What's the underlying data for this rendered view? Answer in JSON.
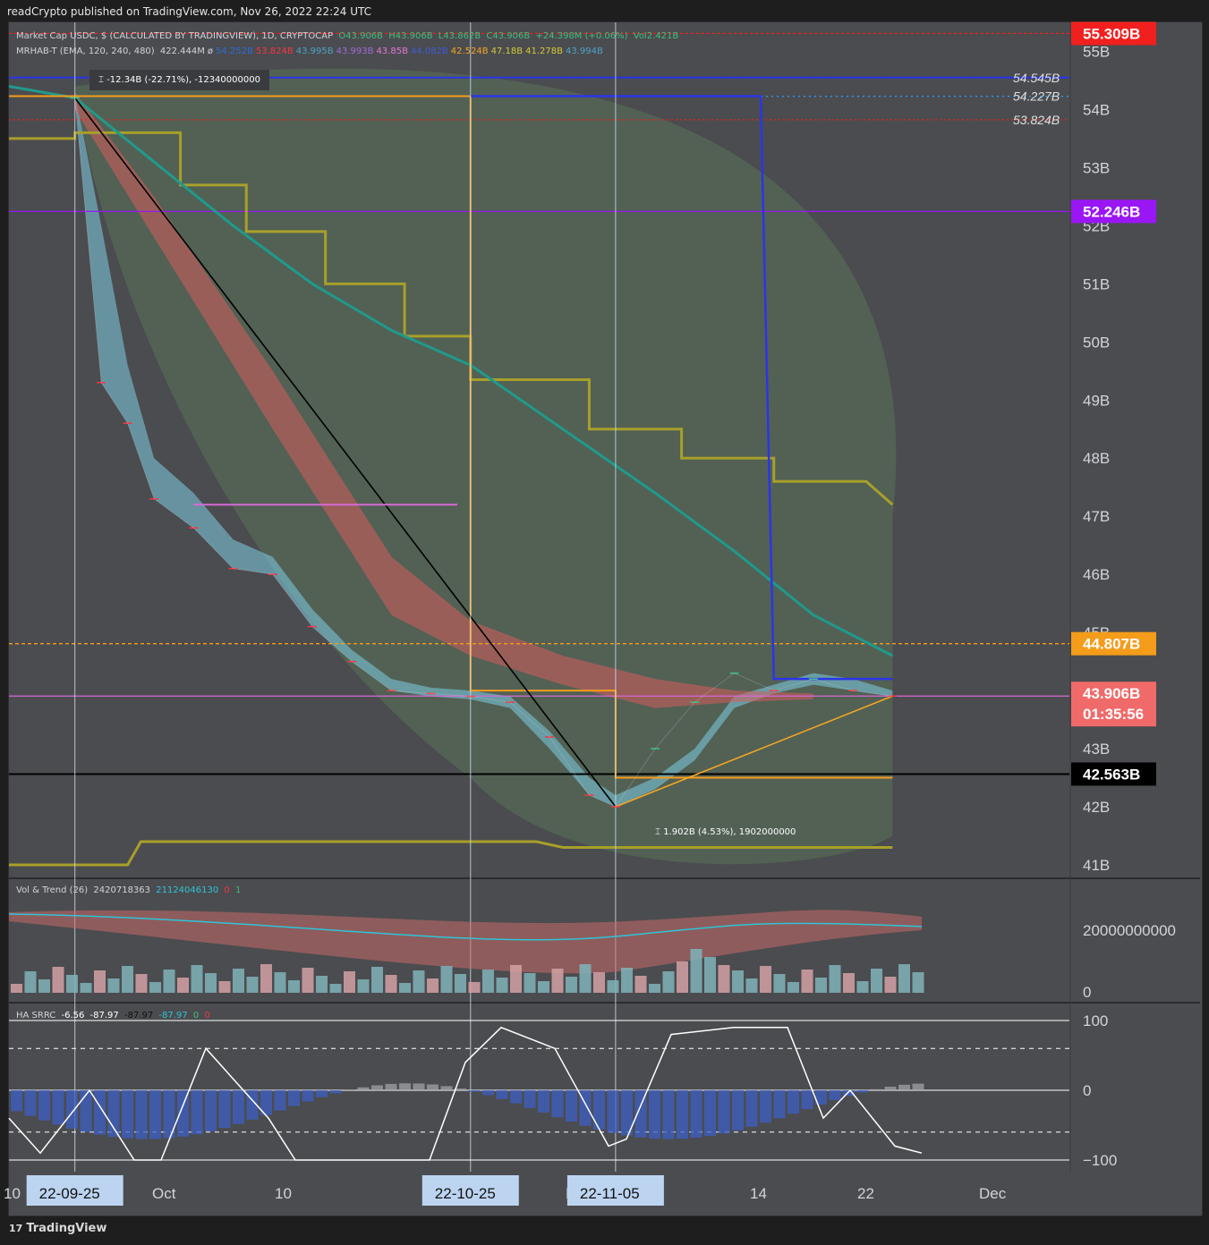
{
  "header": {
    "publisher": "readCrypto published on TradingView.com, Nov 26, 2022 22:24 UTC"
  },
  "footer": {
    "brand": "TradingView",
    "logo_text": "17"
  },
  "legend": {
    "symbol": "Market Cap USDC, $ (CALCULATED BY TRADINGVIEW), 1D, CRYPTOCAP",
    "ohlc": [
      "O43.906B",
      "H43.906B",
      "L43.862B",
      "C43.906B",
      "+24.398M (+0.06%)"
    ],
    "vol": "Vol2.421B",
    "indicator_name": "MRHAB-T (EMA, 120, 240, 480)",
    "indicator_values": [
      "422.444M",
      "ø",
      "54.252B",
      "53.824B",
      "43.995B",
      "43.993B",
      "43.85B",
      "44.082B",
      "42.524B",
      "47.18B",
      "41.278B",
      "43.994B"
    ],
    "indicator_colors": [
      "#d1d4dc",
      "#d1d4dc",
      "#2a6ad8",
      "#f23645",
      "#4ba3c7",
      "#9c6cd8",
      "#e07ad8",
      "#3b5bdb",
      "#f5a623",
      "#d4c93a",
      "#d4c93a",
      "#4ba3c7"
    ]
  },
  "measure_top": "-12.34B (-22.71%), -12340000000",
  "measure_bottom": "1.902B (4.53%), 1902000000",
  "price_axis": {
    "ticks": [
      "55B",
      "54B",
      "53B",
      "52B",
      "51B",
      "50B",
      "49B",
      "48B",
      "47B",
      "46B",
      "45B",
      "43B",
      "42B",
      "41B"
    ],
    "badges": [
      {
        "text": "55.309B",
        "color": "#f21f1f"
      },
      {
        "text": "52.246B",
        "color": "#9a16f5"
      },
      {
        "text": "44.807B",
        "color": "#f59c1a"
      },
      {
        "text": "43.906B",
        "subtext": "01:35:56",
        "color": "#f06a6a"
      },
      {
        "text": "42.563B",
        "color": "#000000"
      }
    ],
    "level_labels": [
      "54.545B",
      "54.227B",
      "53.824B"
    ]
  },
  "volume_pane": {
    "title": "Vol & Trend (26)",
    "values": [
      "2420718363",
      "21124046130",
      "0",
      "1"
    ],
    "ticks": [
      "20000000000",
      "0"
    ]
  },
  "osc_pane": {
    "title": "HA SRRC",
    "values": [
      "-6.56",
      "-87.97",
      "-87.97",
      "-87.97",
      "0",
      "0"
    ],
    "ticks": [
      "100",
      "0",
      "−100"
    ]
  },
  "time_axis": {
    "ticks": [
      "10",
      "Oct",
      "10",
      "No",
      "14",
      "22",
      "Dec"
    ],
    "highlights": [
      "22-09-25",
      "22-10-25",
      "22-11-05"
    ]
  },
  "chart_data": {
    "type": "line",
    "title": "Market Cap USDC, $ (CALCULATED BY TRADINGVIEW), 1D, CRYPTOCAP",
    "x": [
      "2022-09-25",
      "2022-09-27",
      "2022-09-29",
      "2022-10-01",
      "2022-10-04",
      "2022-10-07",
      "2022-10-10",
      "2022-10-13",
      "2022-10-16",
      "2022-10-19",
      "2022-10-22",
      "2022-10-25",
      "2022-10-28",
      "2022-10-31",
      "2022-11-03",
      "2022-11-05",
      "2022-11-08",
      "2022-11-11",
      "2022-11-14",
      "2022-11-17",
      "2022-11-20",
      "2022-11-23",
      "2022-11-26"
    ],
    "series": [
      {
        "name": "Market Cap USDC",
        "values": [
          54.2,
          49.3,
          48.6,
          47.3,
          46.8,
          46.1,
          46.0,
          45.1,
          44.5,
          44.0,
          43.95,
          43.9,
          43.8,
          43.2,
          42.2,
          42.0,
          43.0,
          43.8,
          44.3,
          44.0,
          44.2,
          44.0,
          43.906
        ]
      }
    ],
    "ylim": [
      40.8,
      55.5
    ],
    "yticks": [
      41,
      42,
      43,
      45,
      46,
      47,
      48,
      49,
      50,
      51,
      52,
      53,
      54,
      55
    ],
    "horizontal_levels": [
      55.309,
      54.545,
      54.227,
      53.824,
      52.246,
      44.807,
      43.906,
      42.563
    ],
    "grid": true
  }
}
